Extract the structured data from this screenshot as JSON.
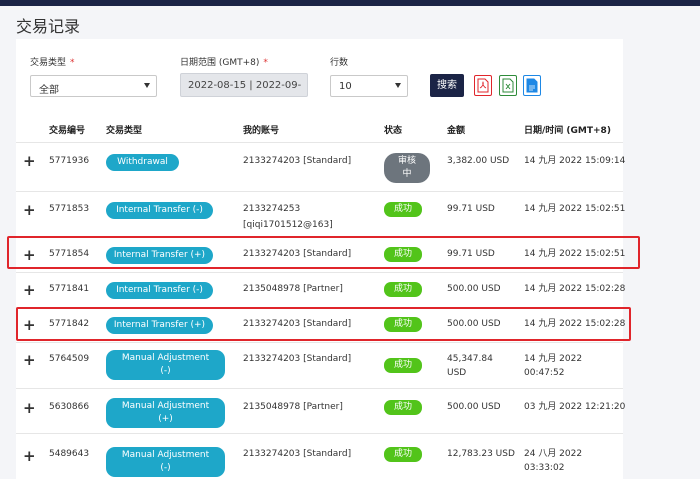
{
  "page": {
    "title": "交易记录"
  },
  "filters": {
    "type_label": "交易类型",
    "type_required": "*",
    "type_value": "全部",
    "date_label": "日期范围 (GMT+8)",
    "date_required": "*",
    "date_value": "2022-08-15 | 2022-09-",
    "rows_label": "行数",
    "rows_value": "10",
    "search_label": "搜索"
  },
  "exports": [
    {
      "name": "pdf-export-icon",
      "color": "#e0252b"
    },
    {
      "name": "excel-export-icon",
      "color": "#2e8b3a"
    },
    {
      "name": "doc-export-icon",
      "color": "#1e88e5"
    }
  ],
  "table": {
    "columns": [
      "交易编号",
      "交易类型",
      "我的账号",
      "状态",
      "金额",
      "日期/时间 (GMT+8)"
    ],
    "rows": [
      {
        "id": "5771936",
        "type_lines": [
          "Withdrawal"
        ],
        "account_lines": [
          "2133274203 [Standard]"
        ],
        "status_lines": [
          "审核",
          "中"
        ],
        "status_kind": "pending",
        "amount_lines": [
          "3,382.00 USD"
        ],
        "date_lines": [
          "14 九月 2022 15:09:14"
        ],
        "highlight": false
      },
      {
        "id": "5771853",
        "type_lines": [
          "Internal Transfer (-)"
        ],
        "account_lines": [
          "2133274253",
          "[qiqi1701512@163]"
        ],
        "status_lines": [
          "成功"
        ],
        "status_kind": "success",
        "amount_lines": [
          "99.71 USD"
        ],
        "date_lines": [
          "14 九月 2022 15:02:51"
        ],
        "highlight": false
      },
      {
        "id": "5771854",
        "type_lines": [
          "Internal Transfer (+)"
        ],
        "account_lines": [
          "2133274203 [Standard]"
        ],
        "status_lines": [
          "成功"
        ],
        "status_kind": "success",
        "amount_lines": [
          "99.71 USD"
        ],
        "date_lines": [
          "14 九月 2022 15:02:51"
        ],
        "highlight": true
      },
      {
        "id": "5771841",
        "type_lines": [
          "Internal Transfer (-)"
        ],
        "account_lines": [
          "2135048978 [Partner]"
        ],
        "status_lines": [
          "成功"
        ],
        "status_kind": "success",
        "amount_lines": [
          "500.00 USD"
        ],
        "date_lines": [
          "14 九月 2022 15:02:28"
        ],
        "highlight": false
      },
      {
        "id": "5771842",
        "type_lines": [
          "Internal Transfer (+)"
        ],
        "account_lines": [
          "2133274203 [Standard]"
        ],
        "status_lines": [
          "成功"
        ],
        "status_kind": "success",
        "amount_lines": [
          "500.00 USD"
        ],
        "date_lines": [
          "14 九月 2022 15:02:28"
        ],
        "highlight": true
      },
      {
        "id": "5764509",
        "type_lines": [
          "Manual Adjustment",
          "(-)"
        ],
        "account_lines": [
          "2133274203 [Standard]"
        ],
        "status_lines": [
          "成功"
        ],
        "status_kind": "success",
        "amount_lines": [
          "45,347.84",
          "USD"
        ],
        "date_lines": [
          "14 九月 2022",
          "00:47:52"
        ],
        "highlight": false
      },
      {
        "id": "5630866",
        "type_lines": [
          "Manual Adjustment",
          "(+)"
        ],
        "account_lines": [
          "2135048978 [Partner]"
        ],
        "status_lines": [
          "成功"
        ],
        "status_kind": "success",
        "amount_lines": [
          "500.00 USD"
        ],
        "date_lines": [
          "03 九月 2022 12:21:20"
        ],
        "highlight": false
      },
      {
        "id": "5489643",
        "type_lines": [
          "Manual Adjustment",
          "(-)"
        ],
        "account_lines": [
          "2133274203 [Standard]"
        ],
        "status_lines": [
          "成功"
        ],
        "status_kind": "success",
        "amount_lines": [
          "12,783.23 USD"
        ],
        "date_lines": [
          "24 八月 2022",
          "03:33:02"
        ],
        "highlight": false
      }
    ]
  },
  "colors": {
    "navy": "#1b2446",
    "pill": "#1ea7c9",
    "success": "#52c41a",
    "pending": "#6d757d",
    "highlight": "#e0252b"
  }
}
